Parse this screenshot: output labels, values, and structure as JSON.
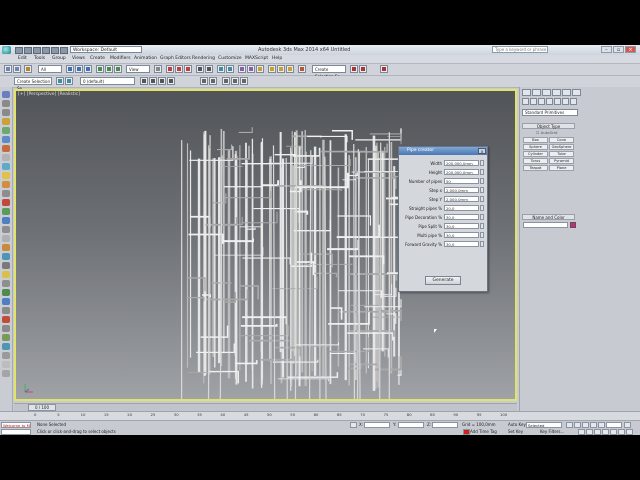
{
  "window": {
    "workspace": "Workspace: Default",
    "title": "Autodesk 3ds Max 2014 x64    Untitled",
    "search_placeholder": "Type a keyword or phrase"
  },
  "menu": {
    "items": [
      "Edit",
      "Tools",
      "Group",
      "Views",
      "Create",
      "Modifiers",
      "Animation",
      "Graph Editors",
      "Rendering",
      "Customize",
      "MAXScript",
      "Help"
    ]
  },
  "toolbar": {
    "filter_select": "All",
    "coord_select": "View",
    "selection_set_select": "Create Selection Se",
    "layer_select": "0 (default)"
  },
  "viewport": {
    "label": "[+] [Perspective] [Realistic]"
  },
  "pipe_dialog": {
    "title": "Pipe creator",
    "close": "x",
    "fields": [
      {
        "label": "Width",
        "value": "200,000,0mm"
      },
      {
        "label": "Height",
        "value": "200,000,0mm"
      },
      {
        "label": "Number of pipes",
        "value": "50"
      },
      {
        "label": "Step x",
        "value": "2,000,0mm"
      },
      {
        "label": "Step Y",
        "value": "2,000,0mm"
      },
      {
        "label": "Straight pipes %",
        "value": "20,0"
      },
      {
        "label": "Pipe Decoration %",
        "value": "30,0"
      },
      {
        "label": "Pipe Split %",
        "value": "30,0"
      },
      {
        "label": "Multi pipe %",
        "value": "30,0"
      },
      {
        "label": "Forward Gravity %",
        "value": "30,0"
      }
    ],
    "generate_label": "Generate"
  },
  "command_panel": {
    "category_select": "Standard Primitives",
    "object_type_header": "Object Type",
    "autogrid_label": "AutoGrid",
    "buttons": [
      "Box",
      "Cone",
      "Sphere",
      "GeoSphere",
      "Cylinder",
      "Tube",
      "Torus",
      "Pyramid",
      "Teapot",
      "Plane"
    ],
    "name_color_header": "Name and Color"
  },
  "timeline": {
    "slider": "0 / 100",
    "ticks": [
      "0",
      "5",
      "10",
      "15",
      "20",
      "25",
      "30",
      "35",
      "40",
      "45",
      "50",
      "55",
      "60",
      "65",
      "70",
      "75",
      "80",
      "85",
      "90",
      "95",
      "100"
    ]
  },
  "status_bar": {
    "maxscript_label": "Welcome to M",
    "selection_status": "None Selected",
    "prompt": "Click or click-and-drag to select objects",
    "x_label": "X:",
    "y_label": "Y:",
    "z_label": "Z:",
    "grid": "Grid = 100,0mm",
    "add_time_tag": "Add Time Tag",
    "auto_key": "Auto Key",
    "set_key": "Set Key",
    "selected": "Selected",
    "key_filters": "Key Filters..."
  },
  "colors": {
    "viewport_border": "#e3e36a",
    "dialog_title": "#4b78b3",
    "object_color": "#d4257a",
    "time_tag_red": "#ff0000"
  }
}
